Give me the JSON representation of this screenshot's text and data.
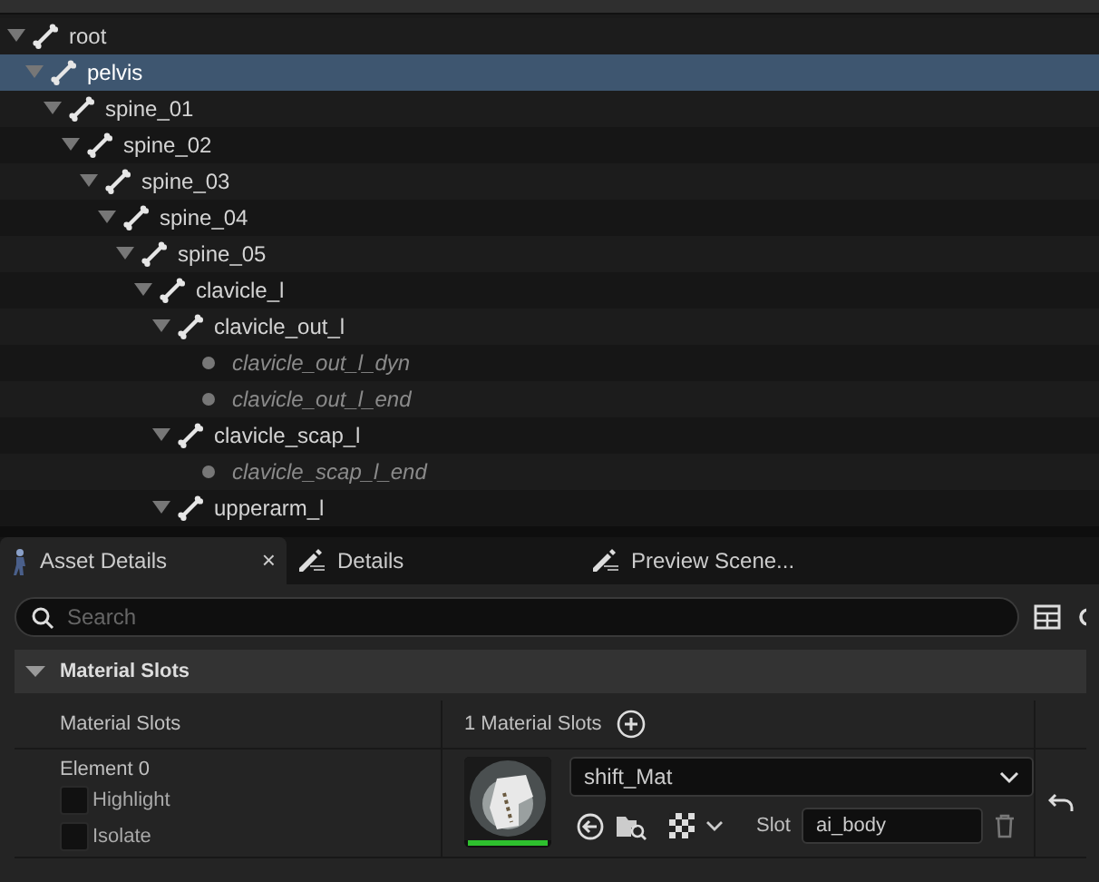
{
  "tree": [
    {
      "name": "root",
      "kind": "bone",
      "expanded": true,
      "selected": false,
      "children": [
        {
          "name": "pelvis",
          "kind": "bone",
          "expanded": true,
          "selected": true,
          "children": [
            {
              "name": "spine_01",
              "kind": "bone",
              "expanded": true,
              "selected": false,
              "children": [
                {
                  "name": "spine_02",
                  "kind": "bone",
                  "expanded": true,
                  "selected": false,
                  "children": [
                    {
                      "name": "spine_03",
                      "kind": "bone",
                      "expanded": true,
                      "selected": false,
                      "children": [
                        {
                          "name": "spine_04",
                          "kind": "bone",
                          "expanded": true,
                          "selected": false,
                          "children": [
                            {
                              "name": "spine_05",
                              "kind": "bone",
                              "expanded": true,
                              "selected": false,
                              "children": [
                                {
                                  "name": "clavicle_l",
                                  "kind": "bone",
                                  "expanded": true,
                                  "selected": false,
                                  "children": [
                                    {
                                      "name": "clavicle_out_l",
                                      "kind": "bone",
                                      "expanded": true,
                                      "selected": false,
                                      "children": [
                                        {
                                          "name": "clavicle_out_l_dyn",
                                          "kind": "virtual",
                                          "selected": false
                                        },
                                        {
                                          "name": "clavicle_out_l_end",
                                          "kind": "virtual",
                                          "selected": false
                                        }
                                      ]
                                    },
                                    {
                                      "name": "clavicle_scap_l",
                                      "kind": "bone",
                                      "expanded": true,
                                      "selected": false,
                                      "children": [
                                        {
                                          "name": "clavicle_scap_l_end",
                                          "kind": "virtual",
                                          "selected": false
                                        }
                                      ]
                                    },
                                    {
                                      "name": "upperarm_l",
                                      "kind": "bone",
                                      "expanded": true,
                                      "selected": false
                                    }
                                  ]
                                }
                              ]
                            }
                          ]
                        }
                      ]
                    }
                  ]
                }
              ]
            }
          ]
        }
      ]
    }
  ],
  "tabs": [
    {
      "label": "Asset Details",
      "kind": "figure",
      "selected": true,
      "close": "×"
    },
    {
      "label": "Details",
      "kind": "pencil",
      "selected": false
    },
    {
      "label": "Preview Scene...",
      "kind": "pencil",
      "selected": false
    }
  ],
  "search": {
    "placeholder": "Search"
  },
  "section": {
    "title": "Material Slots",
    "expanded": true
  },
  "slots_row": {
    "label": "Material Slots",
    "value": "1 Material Slots"
  },
  "element": {
    "label": "Element 0",
    "options": [
      {
        "label": "Highlight",
        "checked": false
      },
      {
        "label": "Isolate",
        "checked": false
      }
    ],
    "material": "shift_Mat",
    "slot_label": "Slot",
    "slot_value": "ai_body"
  }
}
